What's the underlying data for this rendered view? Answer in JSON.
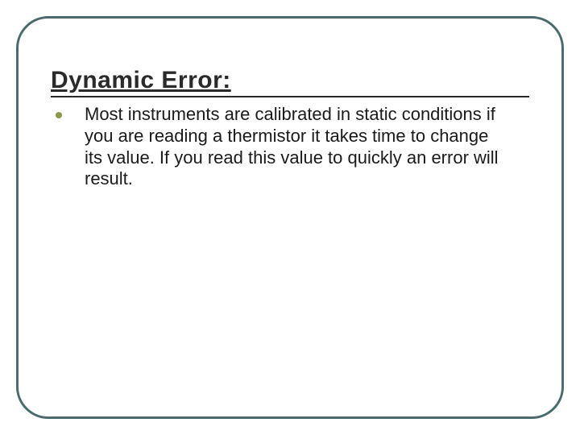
{
  "slide": {
    "title": "Dynamic Error:",
    "bullets": [
      {
        "text": "Most instruments are calibrated in static conditions if you are reading a thermistor it takes time to change its value.  If you read this value to quickly an error will result."
      }
    ]
  },
  "colors": {
    "frame_border": "#4a6b6b",
    "bullet_accent": "#8a9a4a",
    "text": "#1a1a1a"
  }
}
